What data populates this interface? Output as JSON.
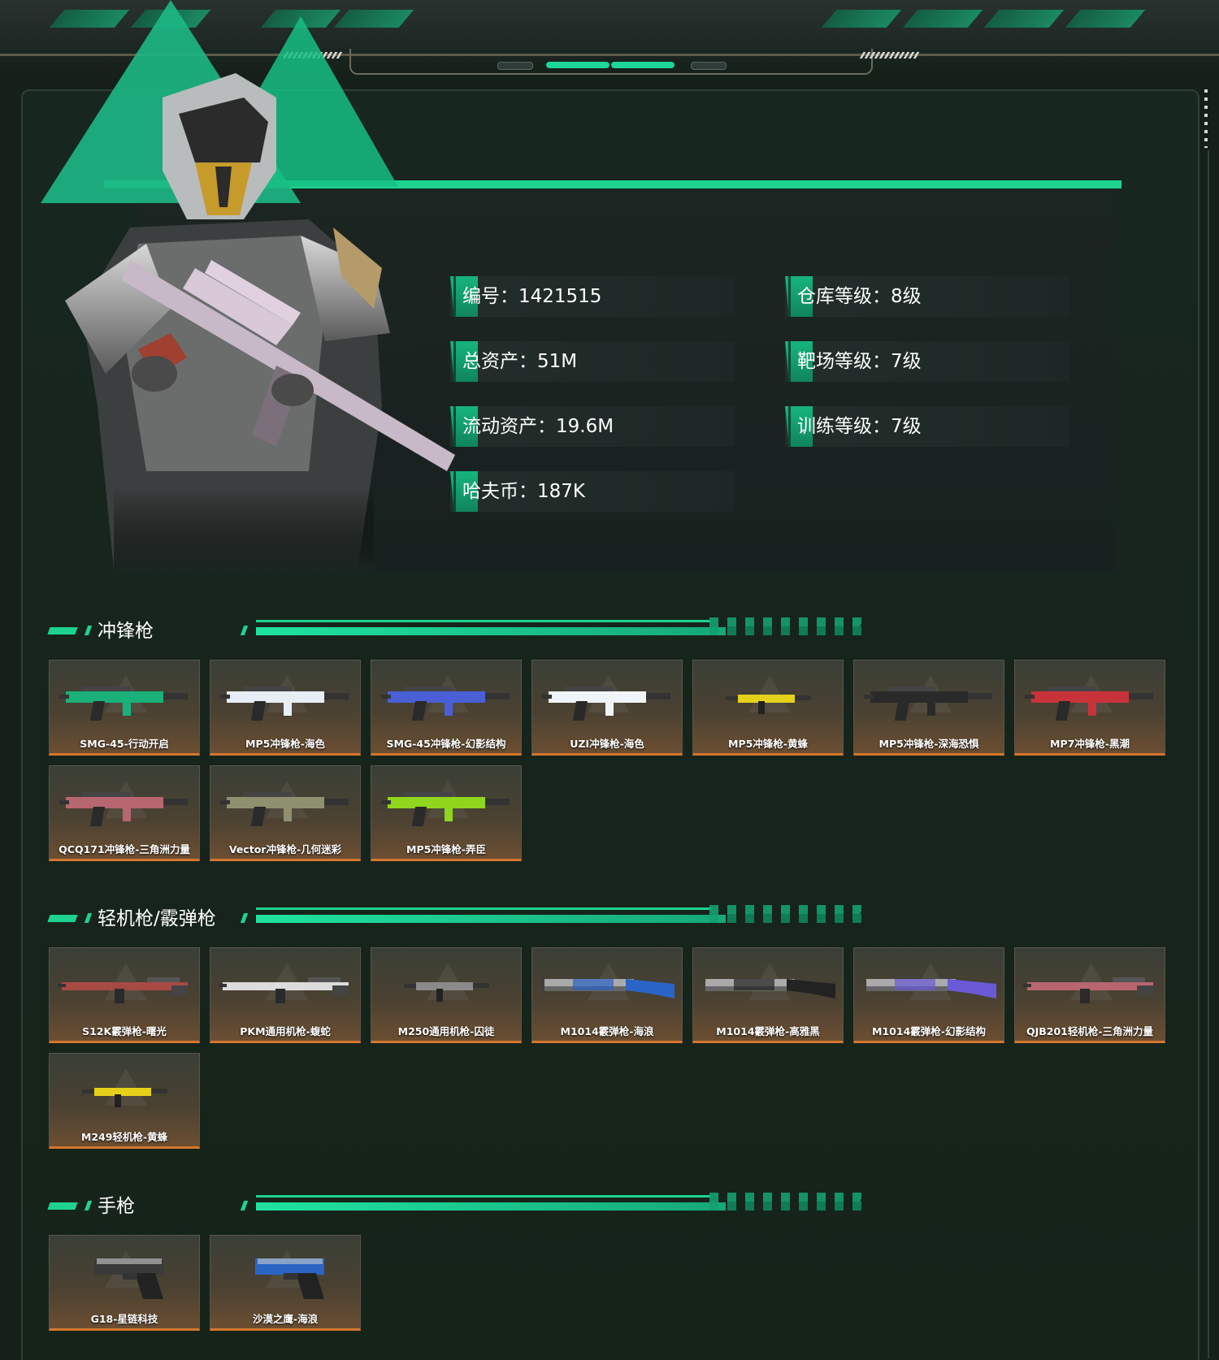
{
  "profile": {
    "stats_left": [
      {
        "label": "编号：1421515"
      },
      {
        "label": "总资产：51M"
      },
      {
        "label": "流动资产：19.6M"
      },
      {
        "label": "哈夫币：187K"
      }
    ],
    "stats_right": [
      {
        "label": "仓库等级：8级"
      },
      {
        "label": "靶场等级：7级"
      },
      {
        "label": "训练等级：7级"
      }
    ]
  },
  "colors": {
    "accent": "#1ed38f",
    "card_bottom": "#d4762d",
    "background": "#142018"
  },
  "sections": [
    {
      "title": "冲锋枪",
      "items": [
        {
          "name": "SMG-45-行动开启",
          "color": "#1ab07a",
          "kind": "smg"
        },
        {
          "name": "MP5冲锋枪-海色",
          "color": "#e8eef5",
          "kind": "smg"
        },
        {
          "name": "SMG-45冲锋枪-幻影结构",
          "color": "#4a5fd6",
          "kind": "smg"
        },
        {
          "name": "UZI冲锋枪-海色",
          "color": "#f0f4f8",
          "kind": "smg"
        },
        {
          "name": "MP5冲锋枪-黄蜂",
          "color": "#e5d11a",
          "kind": "small"
        },
        {
          "name": "MP5冲锋枪-深海恐惧",
          "color": "#2a2a2a",
          "kind": "smg"
        },
        {
          "name": "MP7冲锋枪-黑潮",
          "color": "#c8333a",
          "kind": "smg"
        },
        {
          "name": "QCQ171冲锋枪-三角洲力量",
          "color": "#b86670",
          "kind": "smg"
        },
        {
          "name": "Vector冲锋枪-几何迷彩",
          "color": "#8f9070",
          "kind": "smg"
        },
        {
          "name": "MP5冲锋枪-弄臣",
          "color": "#8fd61c",
          "kind": "smg"
        }
      ]
    },
    {
      "title": "轻机枪/霰弹枪",
      "items": [
        {
          "name": "S12K霰弹枪-曙光",
          "color": "#a84a44",
          "kind": "rifle"
        },
        {
          "name": "PKM通用机枪-蝮蛇",
          "color": "#dcdcdc",
          "kind": "rifle"
        },
        {
          "name": "M250通用机枪-囚徒",
          "color": "#8a8a8a",
          "kind": "small"
        },
        {
          "name": "M1014霰弹枪-海浪",
          "color": "#2a64c4",
          "kind": "shotgun"
        },
        {
          "name": "M1014霰弹枪-高雅黑",
          "color": "#222222",
          "kind": "shotgun"
        },
        {
          "name": "M1014霰弹枪-幻影结构",
          "color": "#6a5ad6",
          "kind": "shotgun"
        },
        {
          "name": "QJB201轻机枪-三角洲力量",
          "color": "#b86670",
          "kind": "rifle"
        },
        {
          "name": "M249轻机枪-黄蜂",
          "color": "#e5d11a",
          "kind": "small"
        }
      ]
    },
    {
      "title": "手枪",
      "items": [
        {
          "name": "G18-星链科技",
          "color": "#3a3a3a",
          "kind": "pistol"
        },
        {
          "name": "沙漠之鹰-海浪",
          "color": "#2a64c4",
          "kind": "pistol"
        }
      ]
    }
  ]
}
